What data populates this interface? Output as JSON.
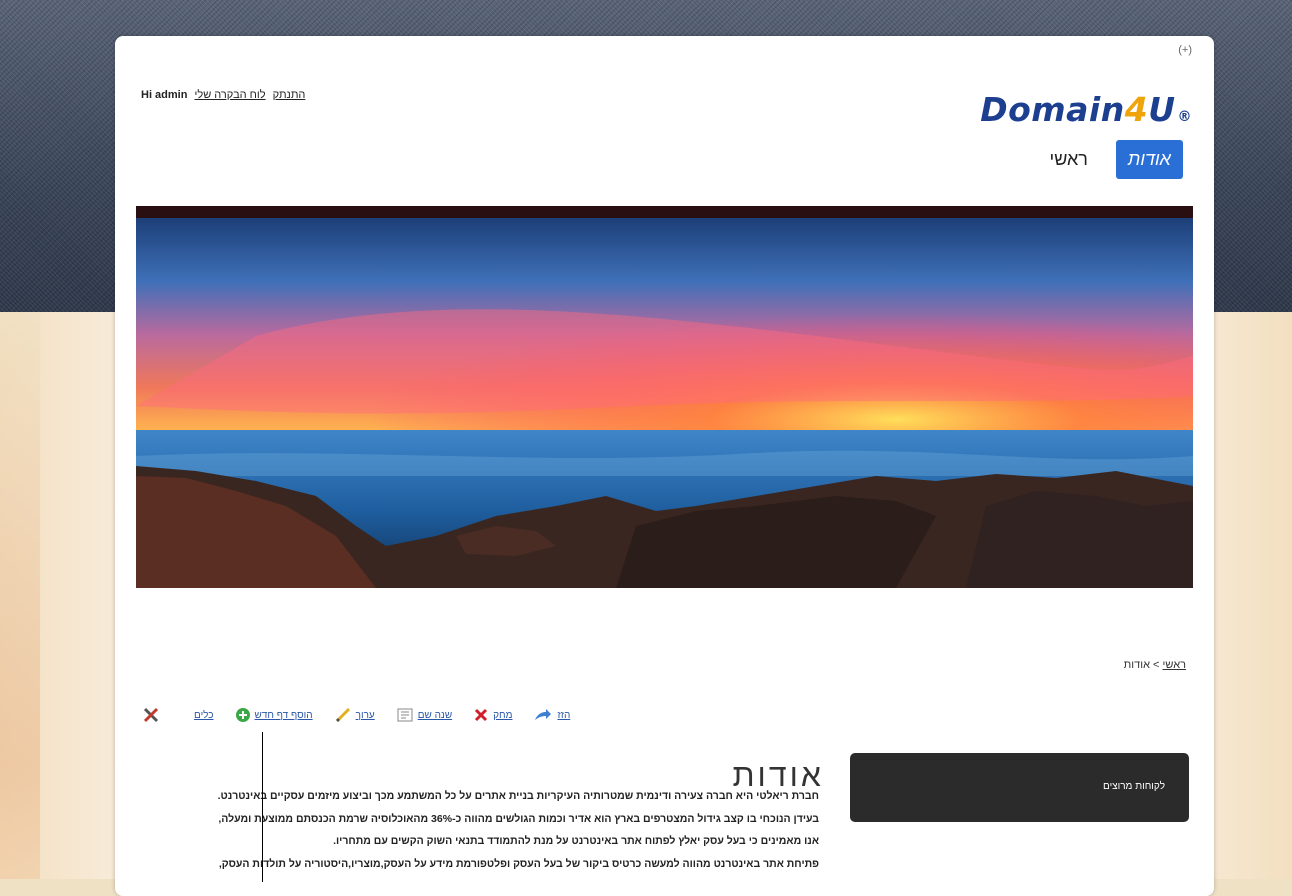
{
  "header": {
    "plus_link": "(+)",
    "greeting": "Hi admin",
    "logout_link": "התנתק",
    "dashboard_link": "לוח הבקרה שלי"
  },
  "logo": {
    "part1": "Domain",
    "part2": "4",
    "part3": "U",
    "reg": "®"
  },
  "nav": {
    "items": [
      {
        "label": "אודות",
        "active": true
      },
      {
        "label": "ראשי",
        "active": false
      }
    ]
  },
  "breadcrumb": {
    "home": "ראשי",
    "separator": " > ",
    "current": "אודות"
  },
  "toolbar": {
    "tools_label": "כלים",
    "add_page_label": "הוסף דף חדש",
    "edit_label": "ערוך",
    "rename_label": "שנה שם",
    "delete_label": "מחק",
    "move_label": "הזז"
  },
  "content": {
    "title": "אודות",
    "paragraphs": [
      "חברת ריאלטי היא חברה צעירה ודינמית שמטרותיה העיקריות בניית אתרים על כל המשתמע מכך וביצוע מיזמים עסקיים באינטרנט.",
      "בעידן הנוכחי בו קצב גידול המצטרפים בארץ הוא אדיר וכמות הגולשים מהווה כ-36% מהאוכלוסיה שרמת הכנסתם ממוצעת ומעלה,",
      "אנו מאמינים כי בעל עסק יאלץ לפתוח אתר באינטרנט על מנת להתמודד בתנאי השוק הקשים עם מתחריו.",
      "פתיחת אתר באינטרנט מהווה למעשה כרטיס ביקור של בעל העסק ופלטפורמת מידע על העסק,מוצריו,היסטוריה על תולדות העסק,"
    ]
  },
  "sidebar": {
    "box_title": "לקוחות מרוצים"
  },
  "colors": {
    "nav_active": "#2a6fd6",
    "logo_blue": "#1d3f8f",
    "logo_orange": "#f0a40b",
    "link": "#2b57a8"
  }
}
